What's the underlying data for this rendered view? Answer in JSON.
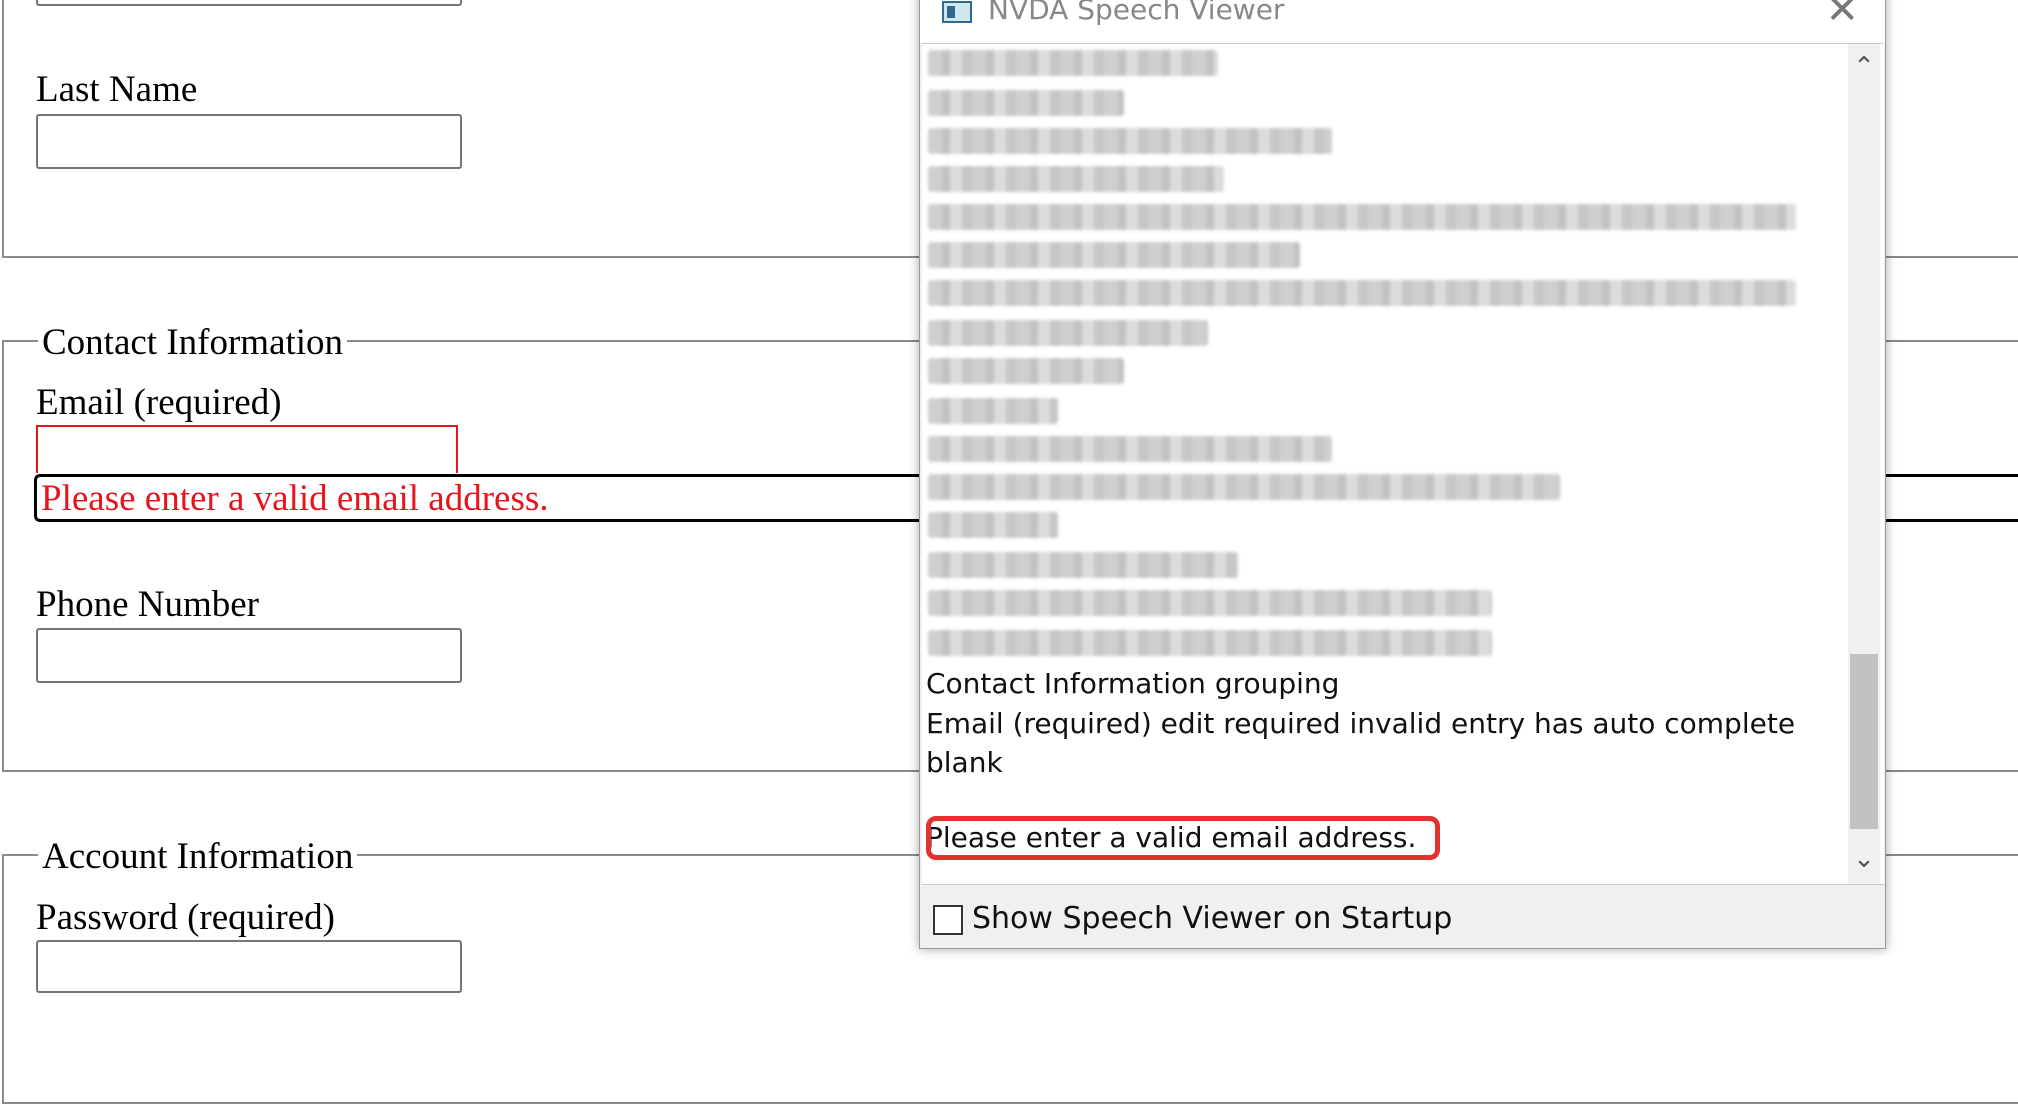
{
  "form": {
    "name_section": {
      "last_name_label": "Last Name"
    },
    "contact_section": {
      "legend": "Contact Information",
      "email_label": "Email (required)",
      "email_error": "Please enter a valid email address.",
      "phone_label": "Phone Number"
    },
    "account_section": {
      "legend": "Account Information",
      "password_label": "Password (required)"
    }
  },
  "speech_viewer": {
    "title": "NVDA Speech Viewer",
    "close_glyph": "✕",
    "scroll_up_glyph": "⌃",
    "scroll_down_glyph": "⌄",
    "visible_lines": [
      "Contact Information  grouping",
      "Email (required)  edit  required  invalid entry  has auto complete",
      "blank",
      "Please enter a valid email address."
    ],
    "show_on_startup_label": "Show Speech Viewer on Startup",
    "show_on_startup_checked": false,
    "highlight_color": "#e2312f"
  },
  "colors": {
    "error": "#e8141b",
    "fieldset_border": "#8a8a8a"
  }
}
